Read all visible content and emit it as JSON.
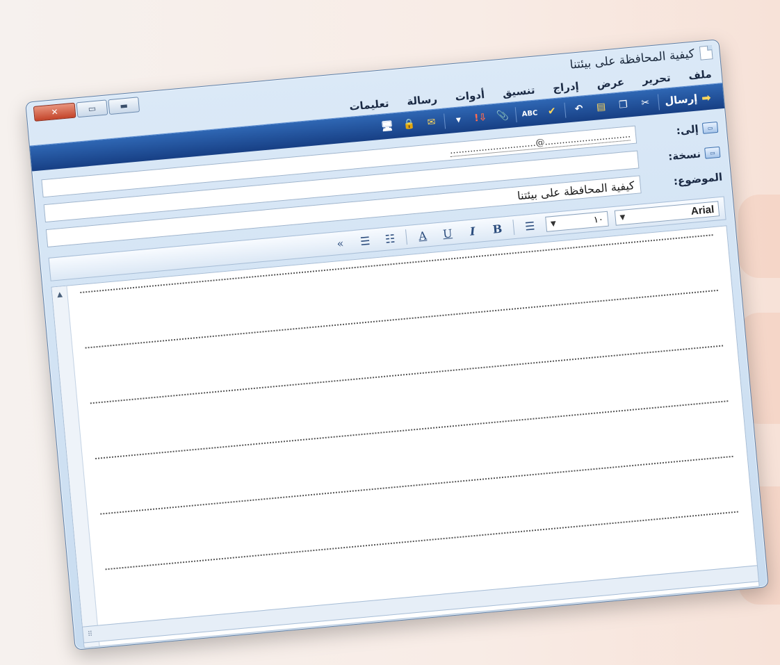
{
  "window": {
    "title": "كيفية المحافظة على بيئتنا"
  },
  "menu": {
    "items": [
      "ملف",
      "تحرير",
      "عرض",
      "إدراج",
      "تنسيق",
      "أدوات",
      "رسالة",
      "تعليمات"
    ]
  },
  "toolbar": {
    "send_label": "إرسال"
  },
  "headers": {
    "to_label": "إلى:",
    "to_value": "..............................@..............................",
    "cc_label": "نسخة:",
    "cc_value": "",
    "subject_label": "الموضوع:",
    "subject_value": "كيفية المحافظة على بيئتنا"
  },
  "format": {
    "font_name": "Arial",
    "font_size": "١٠",
    "bold": "B",
    "italic": "I",
    "underline": "U",
    "color_letter": "A",
    "more": "»"
  },
  "icons": {
    "close": "close-icon",
    "maximize": "maximize-icon",
    "minimize": "minimize-icon",
    "send": "send-icon",
    "address_card": "address-card-icon"
  }
}
